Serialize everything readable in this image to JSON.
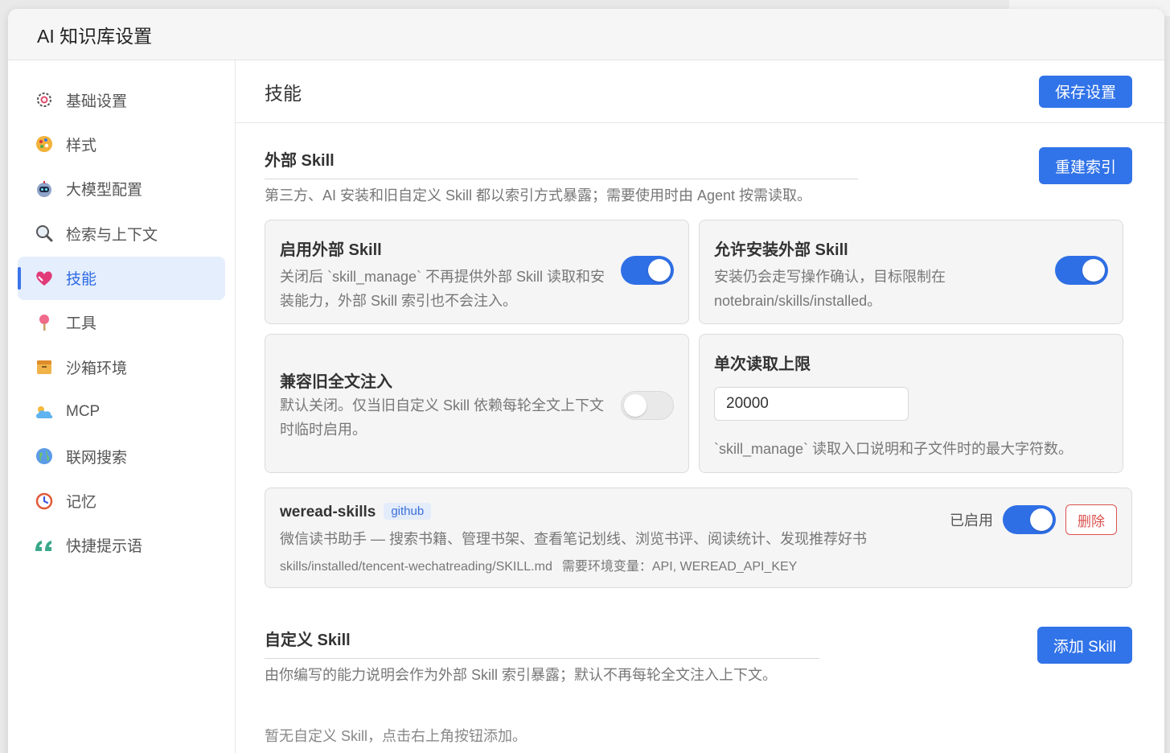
{
  "dialog": {
    "title": "AI 知识库设置"
  },
  "sidebar": {
    "items": [
      {
        "label": "基础设置",
        "icon": "gear-icon"
      },
      {
        "label": "样式",
        "icon": "palette-icon"
      },
      {
        "label": "大模型配置",
        "icon": "robot-icon"
      },
      {
        "label": "检索与上下文",
        "icon": "magnifier-icon"
      },
      {
        "label": "技能",
        "icon": "heart-hands-icon",
        "active": true
      },
      {
        "label": "工具",
        "icon": "pin-icon"
      },
      {
        "label": "沙箱环境",
        "icon": "box-icon"
      },
      {
        "label": "MCP",
        "icon": "cloud-icon"
      },
      {
        "label": "联网搜索",
        "icon": "globe-icon"
      },
      {
        "label": "记忆",
        "icon": "memory-icon"
      },
      {
        "label": "快捷提示语",
        "icon": "quote-icon"
      }
    ]
  },
  "main": {
    "title": "技能",
    "save_label": "保存设置",
    "external": {
      "title": "外部 Skill",
      "desc": "第三方、AI 安装和旧自定义 Skill 都以索引方式暴露；需要使用时由 Agent 按需读取。",
      "rebuild_label": "重建索引",
      "cards": {
        "enable": {
          "title": "启用外部 Skill",
          "desc": "关闭后 `skill_manage` 不再提供外部 Skill 读取和安装能力，外部 Skill 索引也不会注入。",
          "on": true
        },
        "allow_install": {
          "title": "允许安装外部 Skill",
          "desc": "安装仍会走写操作确认，目标限制在 notebrain/skills/installed。",
          "on": true
        },
        "legacy": {
          "title": "兼容旧全文注入",
          "desc": "默认关闭。仅当旧自定义 Skill 依赖每轮全文上下文时临时启用。",
          "on": false
        },
        "read_limit": {
          "title": "单次读取上限",
          "value": "20000",
          "desc": "`skill_manage` 读取入口说明和子文件时的最大字符数。"
        }
      },
      "skill": {
        "name": "weread-skills",
        "badge": "github",
        "desc": "微信读书助手 — 搜索书籍、管理书架、查看笔记划线、浏览书评、阅读统计、发现推荐好书",
        "path": "skills/installed/tencent-wechatreading/SKILL.md",
        "env": "需要环境变量：API, WEREAD_API_KEY",
        "status": "已启用",
        "on": true,
        "delete_label": "删除"
      }
    },
    "custom": {
      "title": "自定义 Skill",
      "desc": "由你编写的能力说明会作为外部 Skill 索引暴露；默认不再每轮全文注入上下文。",
      "add_label": "添加 Skill",
      "empty": "暂无自定义 Skill，点击右上角按钮添加。"
    }
  },
  "colors": {
    "accent": "#3173e8",
    "danger": "#d9534f"
  }
}
